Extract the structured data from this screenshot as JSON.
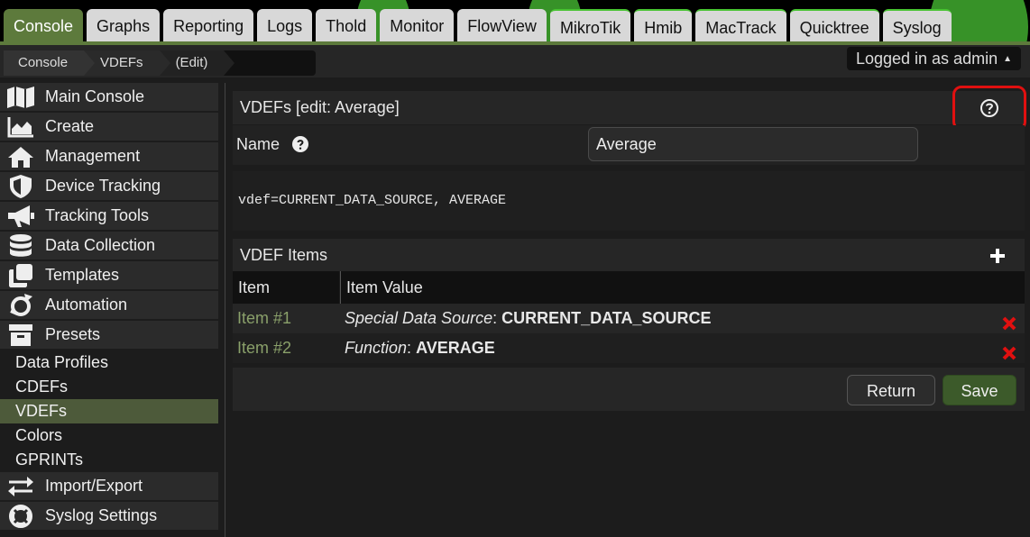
{
  "colors": {
    "accent": "#5d7a3c",
    "tab_bg": "#d8d8d8",
    "plugin_tab_border": "#47c231",
    "delete": "#e01010",
    "item_label": "#8aa06a"
  },
  "tabs": [
    {
      "label": "Console",
      "active": true
    },
    {
      "label": "Graphs"
    },
    {
      "label": "Reporting"
    },
    {
      "label": "Logs"
    },
    {
      "label": "Thold"
    },
    {
      "label": "Monitor"
    },
    {
      "label": "FlowView"
    },
    {
      "label": "MikroTik"
    },
    {
      "label": "Hmib"
    },
    {
      "label": "MacTrack"
    },
    {
      "label": "Quicktree"
    },
    {
      "label": "Syslog"
    }
  ],
  "breadcrumb": [
    "Console",
    "VDEFs",
    "(Edit)"
  ],
  "user": {
    "label": "Logged in as admin"
  },
  "sidebar": {
    "items": [
      {
        "label": "Main Console",
        "icon": "map-icon"
      },
      {
        "label": "Create",
        "icon": "area-chart-icon"
      },
      {
        "label": "Management",
        "icon": "home-icon"
      },
      {
        "label": "Device Tracking",
        "icon": "shield-icon"
      },
      {
        "label": "Tracking Tools",
        "icon": "megaphone-icon"
      },
      {
        "label": "Data Collection",
        "icon": "database-icon"
      },
      {
        "label": "Templates",
        "icon": "clone-icon"
      },
      {
        "label": "Automation",
        "icon": "refresh-icon"
      },
      {
        "label": "Presets",
        "icon": "archive-icon"
      }
    ],
    "presets": [
      {
        "label": "Data Profiles"
      },
      {
        "label": "CDEFs"
      },
      {
        "label": "VDEFs",
        "selected": true
      },
      {
        "label": "Colors"
      },
      {
        "label": "GPRINTs"
      }
    ],
    "items_after": [
      {
        "label": "Import/Export",
        "icon": "exchange-icon"
      },
      {
        "label": "Syslog Settings",
        "icon": "lifebuoy-icon"
      }
    ]
  },
  "main": {
    "title": "VDEFs [edit: Average]",
    "name_label": "Name",
    "name_value": "Average",
    "vdef_string": "vdef=CURRENT_DATA_SOURCE, AVERAGE",
    "items_title": "VDEF Items",
    "columns": [
      "Item",
      "Item Value"
    ],
    "rows": [
      {
        "item": "Item #1",
        "key": "Special Data Source",
        "value": "CURRENT_DATA_SOURCE"
      },
      {
        "item": "Item #2",
        "key": "Function",
        "value": "AVERAGE"
      }
    ],
    "return_label": "Return",
    "save_label": "Save"
  }
}
